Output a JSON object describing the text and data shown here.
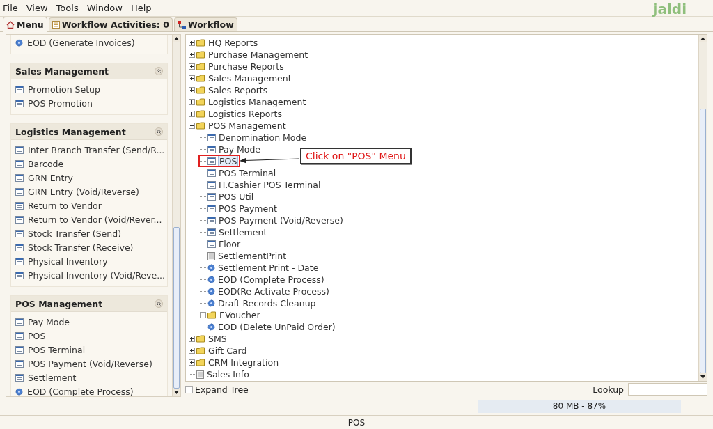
{
  "menu_bar": [
    "File",
    "View",
    "Tools",
    "Window",
    "Help"
  ],
  "logo": "jaldi",
  "tabs": [
    {
      "label": "Menu",
      "kind": "home",
      "selected": true
    },
    {
      "label": "Workflow Activities: 0",
      "kind": "list",
      "selected": false
    },
    {
      "label": "Workflow",
      "kind": "workflow",
      "selected": false
    }
  ],
  "sidebar": {
    "sections": [
      {
        "items": [
          {
            "label": "EOD (Generate Invoices)",
            "kind": "process"
          }
        ]
      },
      {
        "title": "Sales Management",
        "items": [
          {
            "label": "Promotion Setup",
            "kind": "form"
          },
          {
            "label": "POS Promotion",
            "kind": "form"
          }
        ]
      },
      {
        "title": "Logistics Management",
        "items": [
          {
            "label": "Inter Branch Transfer (Send/R...",
            "kind": "form"
          },
          {
            "label": "Barcode",
            "kind": "form"
          },
          {
            "label": "GRN Entry",
            "kind": "form"
          },
          {
            "label": "GRN Entry (Void/Reverse)",
            "kind": "form"
          },
          {
            "label": "Return to Vendor",
            "kind": "form"
          },
          {
            "label": "Return to Vendor (Void/Rever...",
            "kind": "form"
          },
          {
            "label": "Stock Transfer (Send)",
            "kind": "form"
          },
          {
            "label": "Stock Transfer (Receive)",
            "kind": "form"
          },
          {
            "label": "Physical Inventory",
            "kind": "form"
          },
          {
            "label": "Physical Inventory (Void/Reve...",
            "kind": "form"
          }
        ]
      },
      {
        "title": "POS Management",
        "items": [
          {
            "label": "Pay Mode",
            "kind": "form"
          },
          {
            "label": "POS",
            "kind": "form"
          },
          {
            "label": "POS Terminal",
            "kind": "form"
          },
          {
            "label": "POS Payment (Void/Reverse)",
            "kind": "form"
          },
          {
            "label": "Settlement",
            "kind": "form"
          },
          {
            "label": "EOD (Complete Process)",
            "kind": "process"
          }
        ]
      }
    ]
  },
  "tree": [
    {
      "label": "HQ Reports",
      "kind": "folder",
      "expanded": false
    },
    {
      "label": "Purchase Management",
      "kind": "folder",
      "expanded": false
    },
    {
      "label": "Purchase Reports",
      "kind": "folder",
      "expanded": false
    },
    {
      "label": "Sales Management",
      "kind": "folder",
      "expanded": false
    },
    {
      "label": "Sales Reports",
      "kind": "folder",
      "expanded": false
    },
    {
      "label": "Logistics Management",
      "kind": "folder",
      "expanded": false
    },
    {
      "label": "Logistics Reports",
      "kind": "folder",
      "expanded": false
    },
    {
      "label": "POS Management",
      "kind": "folder",
      "expanded": true,
      "children": [
        {
          "label": "Denomination Mode",
          "kind": "form",
          "selected": false
        },
        {
          "label": "Pay Mode",
          "kind": "form",
          "selected": false
        },
        {
          "label": "POS",
          "kind": "form",
          "selected": true
        },
        {
          "label": "POS Terminal",
          "kind": "form",
          "selected": false
        },
        {
          "label": "H.Cashier POS Terminal",
          "kind": "form",
          "selected": false
        },
        {
          "label": "POS Util",
          "kind": "form",
          "selected": false
        },
        {
          "label": "POS Payment",
          "kind": "form",
          "selected": false
        },
        {
          "label": "POS Payment (Void/Reverse)",
          "kind": "form",
          "selected": false
        },
        {
          "label": "Settlement",
          "kind": "form",
          "selected": false
        },
        {
          "label": "Floor",
          "kind": "form",
          "selected": false
        },
        {
          "label": "SettlementPrint",
          "kind": "report",
          "selected": false
        },
        {
          "label": "Settlement Print - Date",
          "kind": "process",
          "selected": false
        },
        {
          "label": "EOD (Complete Process)",
          "kind": "process",
          "selected": false
        },
        {
          "label": "EOD(Re-Activate Process)",
          "kind": "process",
          "selected": false
        },
        {
          "label": "Draft Records Cleanup",
          "kind": "process",
          "selected": false
        },
        {
          "label": "EVoucher",
          "kind": "folder",
          "expanded": false
        },
        {
          "label": "EOD (Delete UnPaid Order)",
          "kind": "process",
          "selected": false
        }
      ]
    },
    {
      "label": "SMS",
      "kind": "folder",
      "expanded": false
    },
    {
      "label": "Gift Card",
      "kind": "folder",
      "expanded": false
    },
    {
      "label": "CRM Integration",
      "kind": "folder",
      "expanded": false
    },
    {
      "label": "Sales Info",
      "kind": "report",
      "selected": false
    }
  ],
  "annotation": {
    "text": "Click on \"POS\" Menu"
  },
  "expand_tree": {
    "label": "Expand Tree",
    "checked": false
  },
  "lookup": {
    "label": "Lookup"
  },
  "memory": {
    "text": "80 MB - 87%"
  },
  "status_bar": "POS"
}
